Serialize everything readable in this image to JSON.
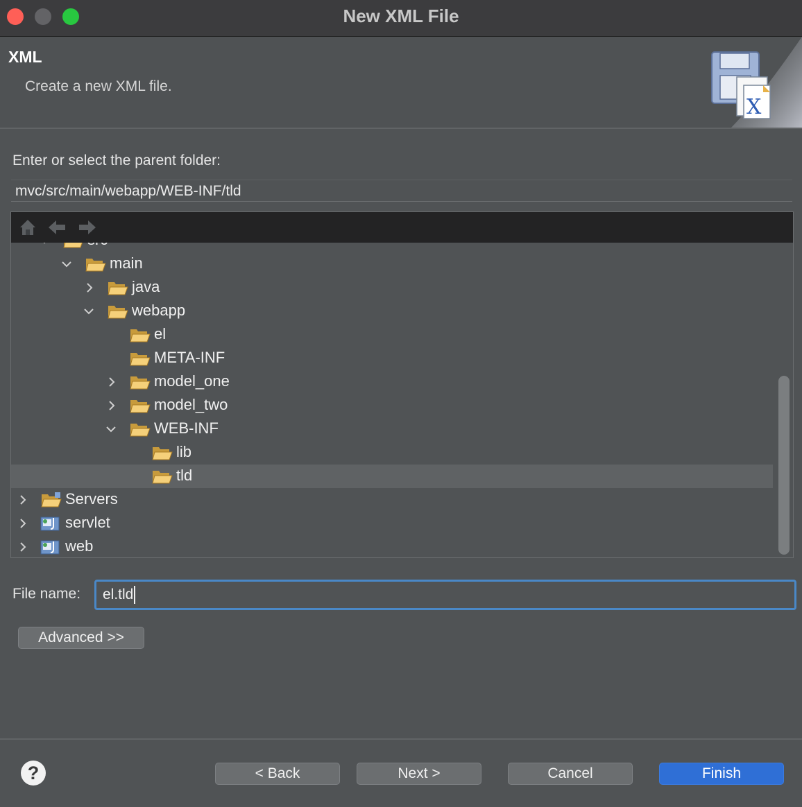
{
  "window": {
    "title": "New XML File"
  },
  "banner": {
    "title": "XML",
    "description": "Create a new XML file."
  },
  "parent_folder": {
    "label": "Enter or select the parent folder:",
    "value": "mvc/src/main/webapp/WEB-INF/tld"
  },
  "tree": {
    "items": [
      {
        "label": "src",
        "state": "expanded",
        "icon": "folder-icon"
      },
      {
        "label": "main",
        "state": "expanded",
        "icon": "folder-icon"
      },
      {
        "label": "java",
        "state": "collapsed",
        "icon": "folder-icon"
      },
      {
        "label": "webapp",
        "state": "expanded",
        "icon": "folder-icon"
      },
      {
        "label": "el",
        "state": "leaf",
        "icon": "folder-icon"
      },
      {
        "label": "META-INF",
        "state": "leaf",
        "icon": "folder-icon"
      },
      {
        "label": "model_one",
        "state": "collapsed",
        "icon": "folder-icon"
      },
      {
        "label": "model_two",
        "state": "collapsed",
        "icon": "folder-icon"
      },
      {
        "label": "WEB-INF",
        "state": "expanded",
        "icon": "folder-icon"
      },
      {
        "label": "lib",
        "state": "leaf",
        "icon": "folder-icon"
      },
      {
        "label": "tld",
        "state": "leaf",
        "icon": "folder-icon",
        "selected": true
      },
      {
        "label": "Servers",
        "state": "collapsed",
        "icon": "folder-icon"
      },
      {
        "label": "servlet",
        "state": "collapsed",
        "icon": "web-project-icon"
      },
      {
        "label": "web",
        "state": "collapsed",
        "icon": "web-project-icon"
      }
    ]
  },
  "file_name": {
    "label": "File name:",
    "value": "el.tld"
  },
  "buttons": {
    "advanced": "Advanced >>",
    "back": "< Back",
    "next": "Next >",
    "cancel": "Cancel",
    "finish": "Finish",
    "help": "?"
  },
  "colors": {
    "accent": "#2f6fd6",
    "focus_ring": "#4a88c7",
    "background": "#505355"
  }
}
